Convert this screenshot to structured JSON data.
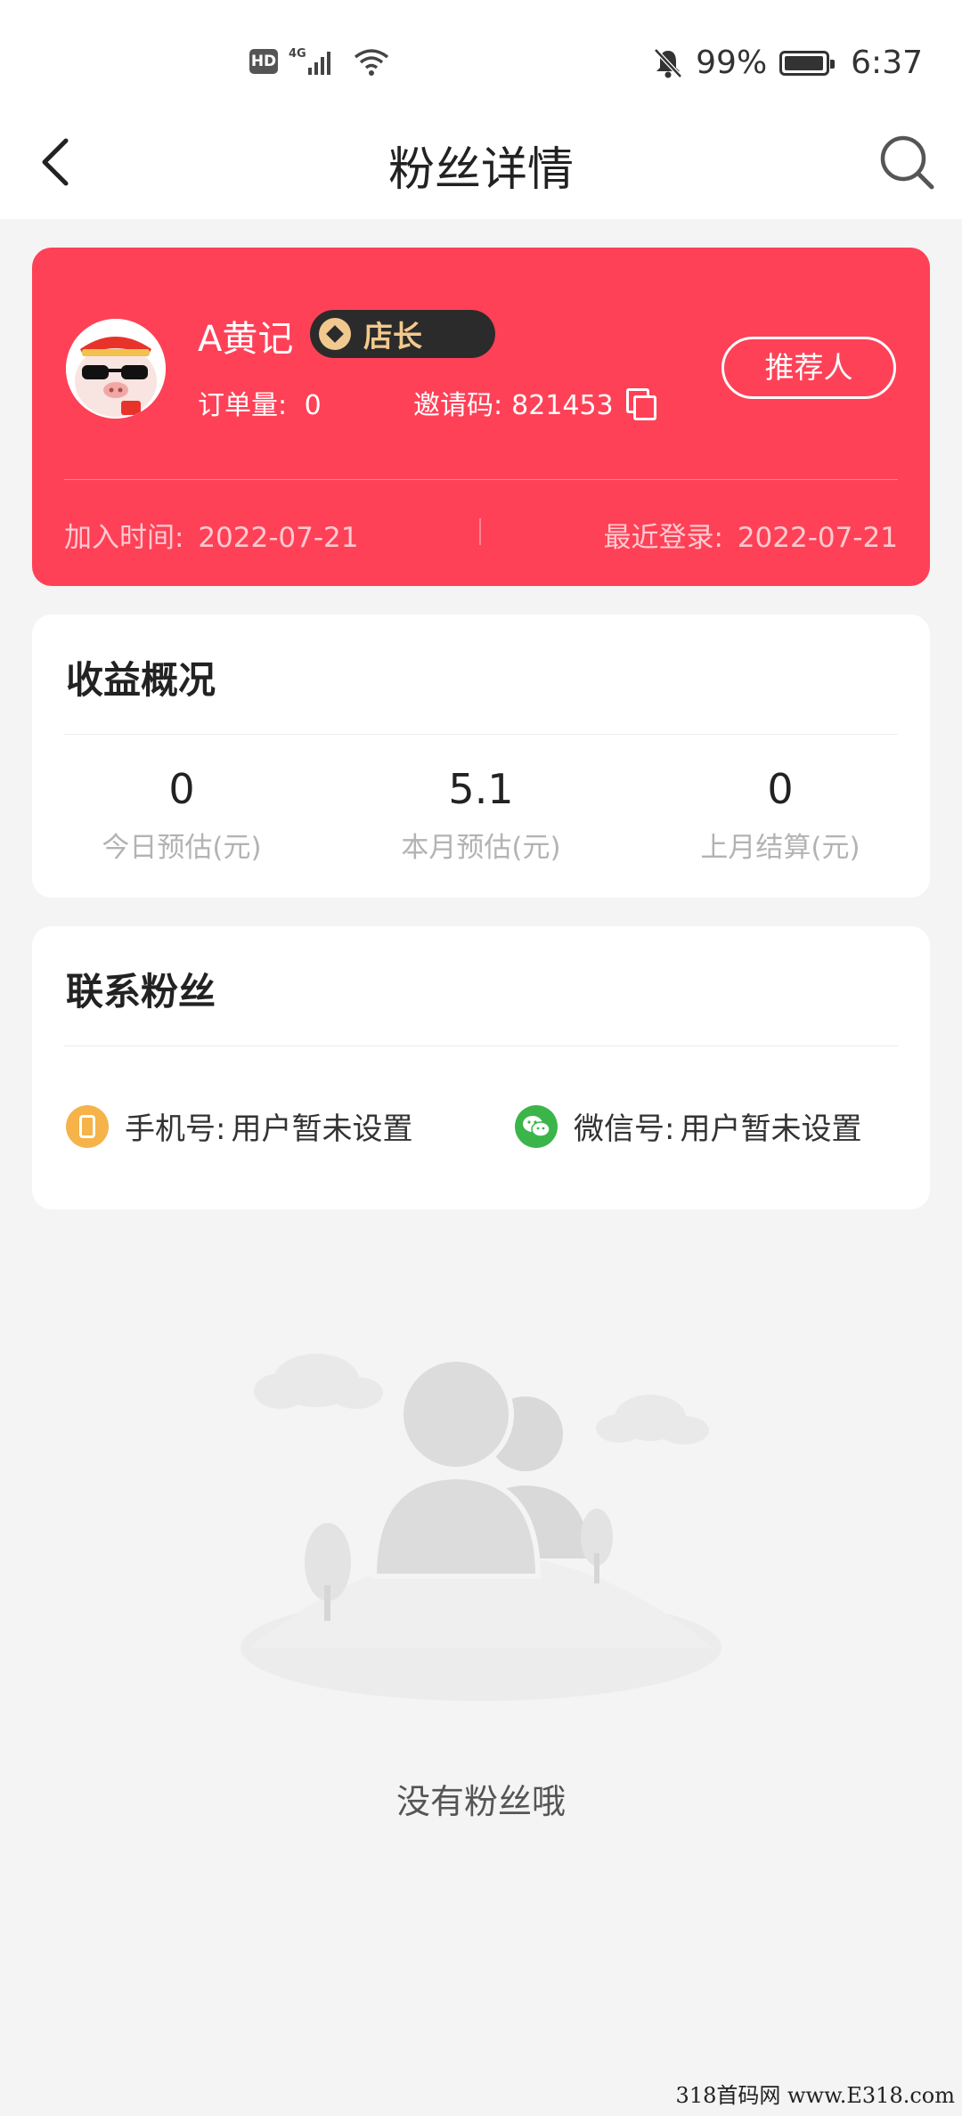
{
  "status_bar": {
    "hd": "HD",
    "network": "4G",
    "battery": "99%",
    "time": "6:37"
  },
  "nav": {
    "title": "粉丝详情",
    "back_icon": "chevron-left-icon",
    "search_icon": "search-icon"
  },
  "profile": {
    "nickname": "A黄记",
    "role": "店长",
    "orders_label": "订单量:",
    "orders": "0",
    "invite_label": "邀请码:",
    "invite_code": "821453",
    "referrer_button": "推荐人",
    "join_label": "加入时间:",
    "join_date": "2022-07-21",
    "login_label": "最近登录:",
    "login_date": "2022-07-21",
    "accent": "#fe4157"
  },
  "earnings": {
    "title": "收益概况",
    "stats": [
      {
        "value": "0",
        "label": "今日预估(元)"
      },
      {
        "value": "5.1",
        "label": "本月预估(元)"
      },
      {
        "value": "0",
        "label": "上月结算(元)"
      }
    ]
  },
  "contact": {
    "title": "联系粉丝",
    "phone_label": "手机号:",
    "phone_value": "用户暂未设置",
    "wechat_label": "微信号:",
    "wechat_value": "用户暂未设置"
  },
  "empty_state": {
    "text": "没有粉丝哦"
  },
  "watermark": "318首码网 www.E318.com"
}
